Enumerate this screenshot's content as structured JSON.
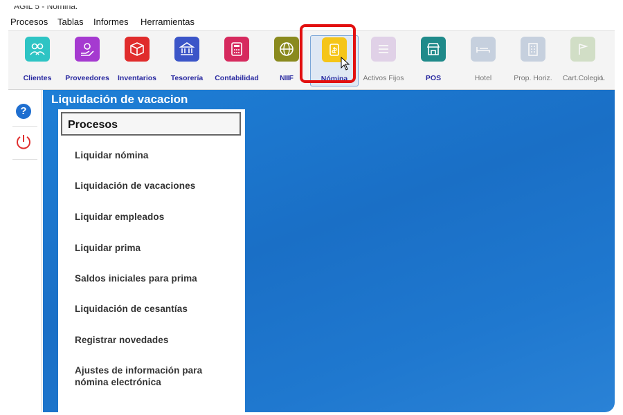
{
  "window": {
    "title": "AGIL 5 - Nómina."
  },
  "menu": {
    "items": [
      "Procesos",
      "Tablas",
      "Informes",
      "Herramientas"
    ]
  },
  "toolbar": {
    "buttons": [
      {
        "label": "Clientes",
        "icon": "users-icon",
        "color": "#2ec4c4"
      },
      {
        "label": "Proveedores",
        "icon": "hand-gear-icon",
        "color": "#a53ad0"
      },
      {
        "label": "Inventarios",
        "icon": "box-icon",
        "color": "#e02c2c"
      },
      {
        "label": "Tesorería",
        "icon": "bank-icon",
        "color": "#3b55c8"
      },
      {
        "label": "Contabilidad",
        "icon": "calculator-icon",
        "color": "#d62a5e"
      },
      {
        "label": "NIIF",
        "icon": "globe-icon",
        "color": "#8a8a1e"
      },
      {
        "label": "Nómina",
        "icon": "payroll-icon",
        "color": "#f5c518"
      },
      {
        "label": "Activos Fijos",
        "icon": "layers-icon",
        "color": "#c9a8d8"
      },
      {
        "label": "POS",
        "icon": "store-icon",
        "color": "#1f8a8a"
      },
      {
        "label": "Hotel",
        "icon": "bed-icon",
        "color": "#8fa6c4"
      },
      {
        "label": "Prop. Horiz.",
        "icon": "building-icon",
        "color": "#8fa6c4"
      },
      {
        "label": "Cart.Colegio",
        "icon": "school-icon",
        "color": "#a8c48f"
      },
      {
        "label": "L",
        "icon": "more-icon",
        "color": "#cccccc"
      }
    ]
  },
  "panel": {
    "title": "Liquidación de vacacion",
    "header": "Procesos",
    "items": [
      "Liquidar nómina",
      "Liquidación de vacaciones",
      "Liquidar empleados",
      "Liquidar prima",
      "Saldos iniciales para prima",
      "Liquidación de cesantías",
      "Registrar novedades",
      "Ajustes de información para nómina electrónica"
    ]
  },
  "colors": {
    "accent": "#1f78cf",
    "highlight": "#e21010"
  }
}
